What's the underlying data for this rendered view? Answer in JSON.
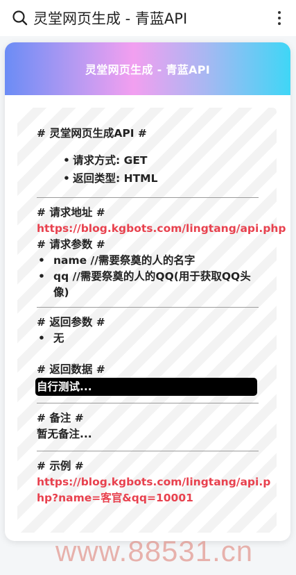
{
  "topbar": {
    "title": "灵堂网页生成 - 青蓝API",
    "search_icon": "search-icon",
    "more_icon": "more-vertical-icon"
  },
  "card": {
    "header_title": "灵堂网页生成 - 青蓝API",
    "section_api_title": "# 灵堂网页生成API #",
    "method": "请求方式: GET",
    "return_type": "返回类型: HTML",
    "url_heading": "# 请求地址 #",
    "url": "https://blog.kgbots.com/lingtang/api.php",
    "params_heading": "# 请求参数 #",
    "params": [
      "name //需要祭奠的人的名字",
      "qq //需要祭奠的人的QQ(用于获取QQ头像)"
    ],
    "return_params_heading": "# 返回参数 #",
    "return_params": [
      "无"
    ],
    "return_data_heading": "# 返回数据 #",
    "return_data": "自行测试...",
    "notes_heading": "# 备注 #",
    "notes": "暂无备注...",
    "example_heading": "# 示例 #",
    "example_url": "https://blog.kgbots.com/lingtang/api.php?name=客官&qq=10001"
  },
  "watermark": "www.88531.cn",
  "colors": {
    "link": "#e8414e",
    "header_gradient_start": "#6b8cf5",
    "header_gradient_mid": "#f29ff0",
    "header_gradient_end": "#3fd6f6"
  }
}
